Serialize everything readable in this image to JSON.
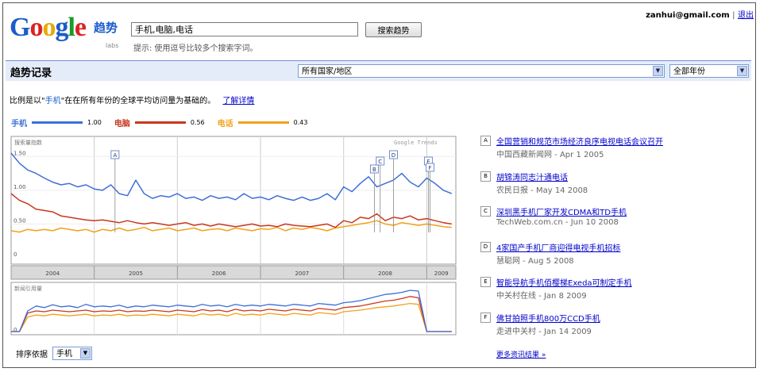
{
  "header": {
    "logo_text": "Google",
    "logo_sub": "趋势",
    "logo_labs": "labs",
    "search_value": "手机,电脑,电话",
    "search_button": "搜索趋势",
    "hint": "提示: 使用逗号比较多个搜索字词。",
    "user_email": "zanhui@gmail.com",
    "separator": "|",
    "logout": "退出"
  },
  "bar": {
    "title": "趋势记录",
    "region_select": "所有国家/地区",
    "year_select": "全部年份"
  },
  "scale_note": {
    "prefix": "比例是以\"",
    "keyword": "手机",
    "suffix": "\"在在所有年份的全球平均访问量为基础的。",
    "link": "了解详情"
  },
  "legend": [
    {
      "term": "手机",
      "value": "1.00",
      "color": "#3d6fd8"
    },
    {
      "term": "电脑",
      "value": "0.56",
      "color": "#c8381e"
    },
    {
      "term": "电话",
      "value": "0.43",
      "color": "#f2a11a"
    }
  ],
  "chart_data": {
    "type": "line",
    "title": "",
    "search_volume_label": "搜索量指数",
    "news_volume_label": "新闻引用量",
    "watermark": "Google Trends",
    "y_ticks": [
      "1.50",
      "1.00",
      "0.50",
      "0"
    ],
    "news_y_ticks": [
      "0"
    ],
    "x_tick_labels": [
      "2004",
      "2005",
      "2006",
      "2007",
      "2008",
      "2009"
    ],
    "x_range": [
      2004.0,
      2009.35
    ],
    "ylim": [
      0,
      1.75
    ],
    "x": [
      2004.0,
      2004.1,
      2004.2,
      2004.3,
      2004.4,
      2004.5,
      2004.6,
      2004.7,
      2004.8,
      2004.9,
      2005.0,
      2005.1,
      2005.2,
      2005.3,
      2005.4,
      2005.5,
      2005.6,
      2005.7,
      2005.8,
      2005.9,
      2006.0,
      2006.1,
      2006.2,
      2006.3,
      2006.4,
      2006.5,
      2006.6,
      2006.7,
      2006.8,
      2006.9,
      2007.0,
      2007.1,
      2007.2,
      2007.3,
      2007.4,
      2007.5,
      2007.6,
      2007.7,
      2007.8,
      2007.9,
      2008.0,
      2008.1,
      2008.2,
      2008.3,
      2008.4,
      2008.5,
      2008.6,
      2008.7,
      2008.8,
      2008.9,
      2009.0,
      2009.1,
      2009.2,
      2009.3
    ],
    "series": [
      {
        "name": "手机",
        "color": "#3d6fd8",
        "values": [
          1.55,
          1.4,
          1.3,
          1.25,
          1.18,
          1.12,
          1.08,
          1.1,
          1.05,
          1.08,
          1.02,
          1.0,
          1.08,
          0.95,
          0.92,
          1.15,
          0.95,
          0.88,
          0.92,
          0.9,
          0.95,
          0.88,
          0.9,
          0.85,
          0.92,
          0.88,
          0.9,
          0.86,
          0.95,
          0.88,
          0.9,
          0.86,
          0.92,
          0.88,
          0.85,
          0.9,
          0.85,
          0.88,
          0.95,
          0.86,
          1.05,
          0.98,
          1.1,
          1.2,
          1.05,
          1.1,
          1.15,
          1.25,
          1.12,
          1.05,
          1.18,
          1.1,
          1.0,
          0.95
        ]
      },
      {
        "name": "电脑",
        "color": "#c8381e",
        "values": [
          0.95,
          0.85,
          0.8,
          0.72,
          0.7,
          0.68,
          0.62,
          0.6,
          0.58,
          0.56,
          0.55,
          0.56,
          0.54,
          0.52,
          0.55,
          0.52,
          0.5,
          0.52,
          0.5,
          0.48,
          0.5,
          0.52,
          0.48,
          0.5,
          0.47,
          0.5,
          0.48,
          0.46,
          0.48,
          0.5,
          0.47,
          0.48,
          0.46,
          0.5,
          0.48,
          0.47,
          0.46,
          0.48,
          0.5,
          0.45,
          0.55,
          0.52,
          0.6,
          0.58,
          0.65,
          0.55,
          0.6,
          0.58,
          0.62,
          0.56,
          0.58,
          0.55,
          0.52,
          0.5
        ]
      },
      {
        "name": "电话",
        "color": "#f2a11a",
        "values": [
          0.4,
          0.38,
          0.42,
          0.4,
          0.42,
          0.4,
          0.44,
          0.42,
          0.4,
          0.42,
          0.38,
          0.42,
          0.4,
          0.44,
          0.4,
          0.42,
          0.45,
          0.4,
          0.42,
          0.44,
          0.4,
          0.42,
          0.44,
          0.4,
          0.42,
          0.43,
          0.4,
          0.44,
          0.42,
          0.4,
          0.43,
          0.42,
          0.45,
          0.4,
          0.44,
          0.42,
          0.45,
          0.43,
          0.4,
          0.44,
          0.46,
          0.48,
          0.5,
          0.52,
          0.55,
          0.5,
          0.48,
          0.52,
          0.5,
          0.48,
          0.5,
          0.48,
          0.46,
          0.45
        ]
      }
    ],
    "news_series": [
      {
        "name": "手机",
        "color": "#3d6fd8",
        "values": [
          0,
          0,
          0.5,
          0.62,
          0.58,
          0.65,
          0.6,
          0.62,
          0.58,
          0.66,
          0.6,
          0.62,
          0.6,
          0.64,
          0.58,
          0.62,
          0.6,
          0.64,
          0.62,
          0.6,
          0.64,
          0.62,
          0.6,
          0.66,
          0.62,
          0.64,
          0.6,
          0.66,
          0.62,
          0.64,
          0.62,
          0.66,
          0.64,
          0.62,
          0.66,
          0.64,
          0.62,
          0.68,
          0.66,
          0.64,
          0.7,
          0.72,
          0.75,
          0.8,
          0.85,
          0.9,
          0.92,
          0.95,
          1.0,
          0.98,
          0,
          0,
          0,
          0
        ]
      },
      {
        "name": "电脑",
        "color": "#c8381e",
        "values": [
          0,
          0,
          0.45,
          0.5,
          0.48,
          0.52,
          0.5,
          0.48,
          0.5,
          0.52,
          0.48,
          0.5,
          0.49,
          0.52,
          0.48,
          0.5,
          0.49,
          0.52,
          0.5,
          0.48,
          0.52,
          0.5,
          0.48,
          0.53,
          0.5,
          0.52,
          0.48,
          0.54,
          0.5,
          0.52,
          0.5,
          0.54,
          0.52,
          0.5,
          0.54,
          0.52,
          0.5,
          0.56,
          0.54,
          0.52,
          0.58,
          0.6,
          0.62,
          0.66,
          0.7,
          0.74,
          0.76,
          0.8,
          0.85,
          0.82,
          0,
          0,
          0,
          0
        ]
      },
      {
        "name": "电话",
        "color": "#f2a11a",
        "values": [
          0,
          0,
          0.35,
          0.4,
          0.38,
          0.42,
          0.4,
          0.38,
          0.4,
          0.42,
          0.38,
          0.4,
          0.39,
          0.42,
          0.38,
          0.4,
          0.39,
          0.42,
          0.4,
          0.38,
          0.42,
          0.4,
          0.38,
          0.43,
          0.4,
          0.42,
          0.38,
          0.44,
          0.4,
          0.42,
          0.4,
          0.44,
          0.42,
          0.4,
          0.44,
          0.42,
          0.4,
          0.46,
          0.44,
          0.42,
          0.48,
          0.5,
          0.52,
          0.55,
          0.58,
          0.6,
          0.62,
          0.65,
          0.68,
          0.66,
          0,
          0,
          0,
          0
        ]
      }
    ],
    "markers": [
      {
        "letter": "A",
        "x": 2005.25
      },
      {
        "letter": "B",
        "x": 2008.37
      },
      {
        "letter": "C",
        "x": 2008.44
      },
      {
        "letter": "D",
        "x": 2008.6
      },
      {
        "letter": "E",
        "x": 2009.02
      },
      {
        "letter": "F",
        "x": 2009.04
      }
    ]
  },
  "news": [
    {
      "letter": "A",
      "title": "全国营销和规范市场经济良序电视电话会议召开",
      "source": "中国西藏新闻网",
      "date": "Apr 1 2005"
    },
    {
      "letter": "B",
      "title": "胡锦涛同志汁通电话",
      "source": "农民日报",
      "date": "May 14 2008"
    },
    {
      "letter": "C",
      "title": "深圳黑手机厂家开发CDMA和TD手机",
      "source": "TechWeb.com.cn",
      "date": "Jun 10 2008"
    },
    {
      "letter": "D",
      "title": "4家国产手机厂商迎得电视手机招标",
      "source": "慧聪网",
      "date": "Aug 5 2008"
    },
    {
      "letter": "E",
      "title": "智能导航手机佰樱梯Exeda可制定手机",
      "source": "中关村在线",
      "date": "Jan 8 2009"
    },
    {
      "letter": "F",
      "title": "佛甘拍照手机800万CCD手机",
      "source": "走进中关村",
      "date": "Jan 14 2009"
    }
  ],
  "more_news": "更多资讯结果 »",
  "sort": {
    "label": "排序依据",
    "value": "手机"
  }
}
